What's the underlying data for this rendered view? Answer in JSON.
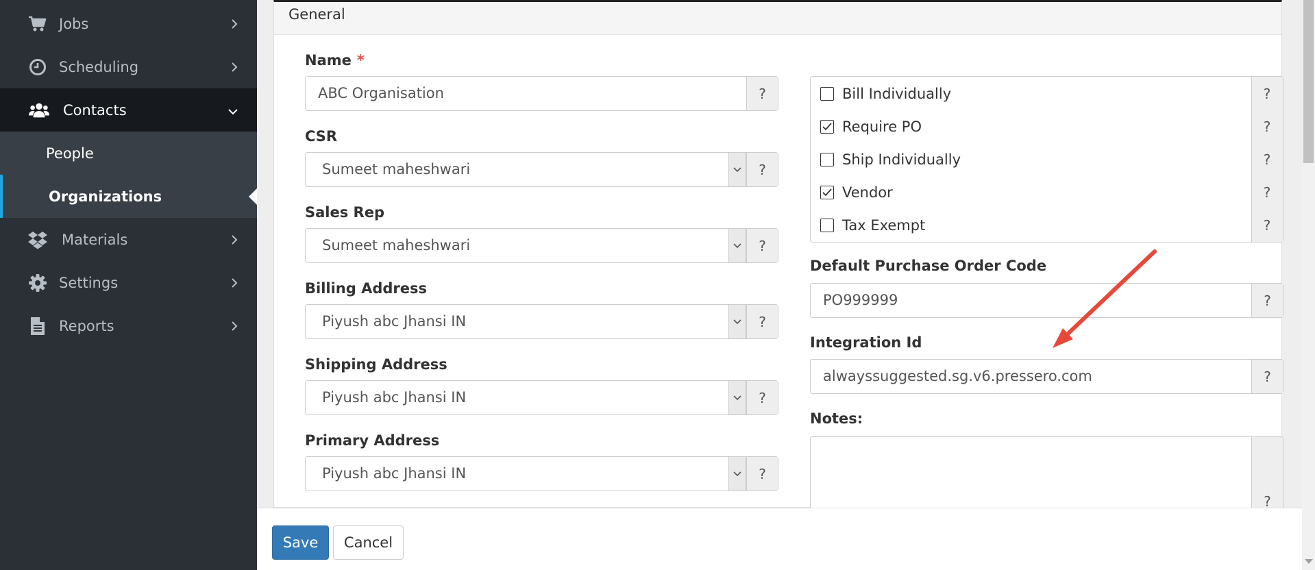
{
  "sidebar": {
    "items": [
      {
        "label": "Jobs",
        "icon": "cart-icon"
      },
      {
        "label": "Scheduling",
        "icon": "clock-icon"
      },
      {
        "label": "Contacts",
        "icon": "users-icon"
      },
      {
        "label": "Materials",
        "icon": "dropbox-icon"
      },
      {
        "label": "Settings",
        "icon": "gear-icon"
      },
      {
        "label": "Reports",
        "icon": "file-icon"
      }
    ],
    "sub_items": [
      {
        "label": "People"
      },
      {
        "label": "Organizations"
      }
    ]
  },
  "panel": {
    "heading": "General"
  },
  "form": {
    "name": {
      "label": "Name",
      "required_mark": "*",
      "value": "ABC Organisation",
      "help": "?"
    },
    "csr": {
      "label": "CSR",
      "value": "Sumeet maheshwari",
      "help": "?"
    },
    "sales_rep": {
      "label": "Sales Rep",
      "value": "Sumeet maheshwari",
      "help": "?"
    },
    "billing_address": {
      "label": "Billing Address",
      "value": "Piyush abc Jhansi IN",
      "help": "?"
    },
    "shipping_address": {
      "label": "Shipping Address",
      "value": "Piyush abc Jhansi IN",
      "help": "?"
    },
    "primary_address": {
      "label": "Primary Address",
      "value": "Piyush abc Jhansi IN",
      "help": "?"
    },
    "checkboxes": [
      {
        "label": "Bill Individually",
        "checked": false,
        "help": "?"
      },
      {
        "label": "Require PO",
        "checked": true,
        "help": "?"
      },
      {
        "label": "Ship Individually",
        "checked": false,
        "help": "?"
      },
      {
        "label": "Vendor",
        "checked": true,
        "help": "?"
      },
      {
        "label": "Tax Exempt",
        "checked": false,
        "help": "?"
      }
    ],
    "default_po_code": {
      "label": "Default Purchase Order Code",
      "value": "PO999999",
      "help": "?"
    },
    "integration_id": {
      "label": "Integration Id",
      "value": "alwayssuggested.sg.v6.pressero.com",
      "help": "?"
    },
    "notes": {
      "label": "Notes:",
      "value": "",
      "help": "?"
    }
  },
  "footer": {
    "save_label": "Save",
    "cancel_label": "Cancel"
  },
  "colors": {
    "sidebar_bg": "#2b3036",
    "active_item_bg": "#16191d",
    "sub_item_bg": "#393f47",
    "active_indicator": "#1ea7e1",
    "primary_button": "#337ab7",
    "required_mark": "#d9534f",
    "annotation_arrow": "#e8483a"
  }
}
